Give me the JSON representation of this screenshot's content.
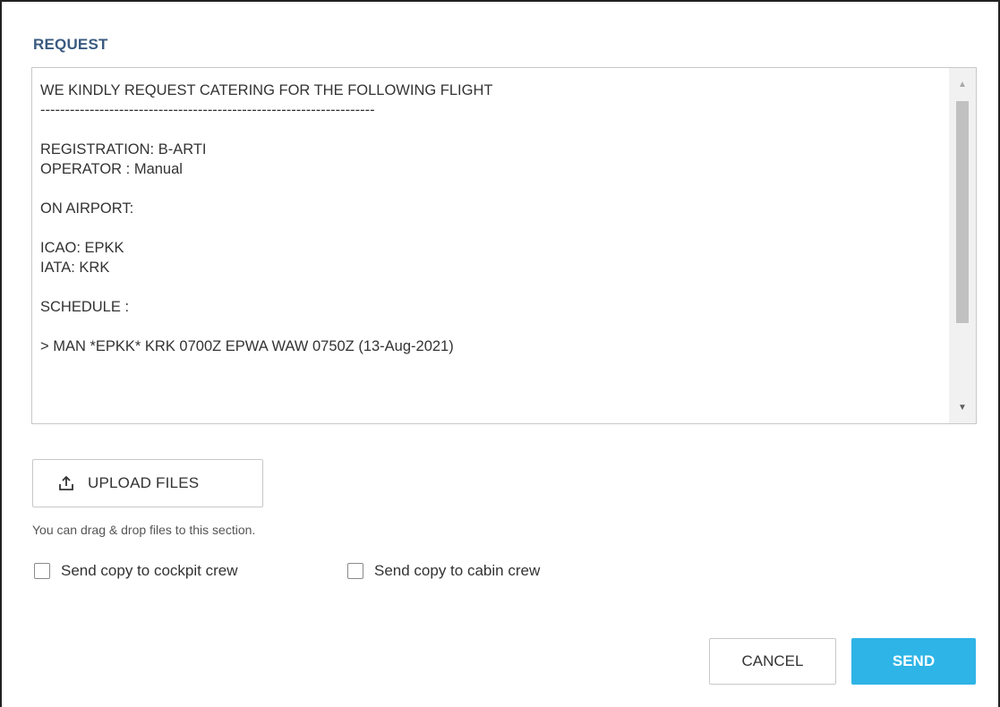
{
  "dialog": {
    "section_title": "REQUEST",
    "request_text": "WE KINDLY REQUEST CATERING FOR THE FOLLOWING FLIGHT\n--------------------------------------------------------------------\n\nREGISTRATION: B-ARTI\nOPERATOR : Manual\n\nON AIRPORT:\n\nICAO: EPKK\nIATA: KRK\n\nSCHEDULE :\n\n> MAN *EPKK* KRK 0700Z EPWA WAW 0750Z (13-Aug-2021)",
    "upload_label": "UPLOAD FILES",
    "upload_icon": "upload-icon",
    "hint": "You can drag & drop files to this section.",
    "checkboxes": [
      {
        "label": "Send copy to cockpit crew",
        "checked": false
      },
      {
        "label": "Send copy to cabin crew",
        "checked": false
      }
    ],
    "cancel_label": "CANCEL",
    "send_label": "SEND"
  },
  "colors": {
    "title": "#3a5a80",
    "send_button": "#2eb4e6",
    "text": "#333333"
  }
}
